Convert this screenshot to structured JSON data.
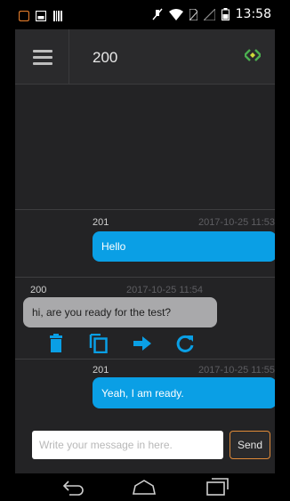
{
  "status_bar": {
    "time": "13:58",
    "left_icons": [
      "app-notification-icon",
      "image-notification-icon",
      "barcode-notification-icon"
    ],
    "right_icons": [
      "mute-icon",
      "wifi-icon",
      "no-sim-icon",
      "signal-icon",
      "battery-icon"
    ]
  },
  "header": {
    "title": "200",
    "menu_icon": "hamburger-menu-icon",
    "status_icon": "connection-status-icon",
    "status_color": "#4caf50"
  },
  "messages": [
    {
      "sender": "201",
      "timestamp": "2017-10-25 11:53",
      "text": "Hello",
      "direction": "outgoing"
    },
    {
      "sender": "200",
      "timestamp": "2017-10-25 11:54",
      "text": "hi, are you ready for the test?",
      "direction": "incoming"
    },
    {
      "sender": "201",
      "timestamp": "2017-10-25 11:55",
      "text": "Yeah,  I am ready.",
      "direction": "outgoing"
    }
  ],
  "message_actions": [
    {
      "icon": "trash-icon"
    },
    {
      "icon": "copy-icon"
    },
    {
      "icon": "forward-icon"
    },
    {
      "icon": "retry-icon"
    }
  ],
  "composer": {
    "placeholder": "Write your message in here.",
    "value": "",
    "send_label": "Send"
  },
  "nav_bar": {
    "icons": [
      "back-icon",
      "home-icon",
      "recent-apps-icon"
    ]
  },
  "colors": {
    "accent": "#0a9fe5",
    "incoming_bubble": "#a9a9ab",
    "send_border": "#e08a38",
    "background": "#232325"
  }
}
